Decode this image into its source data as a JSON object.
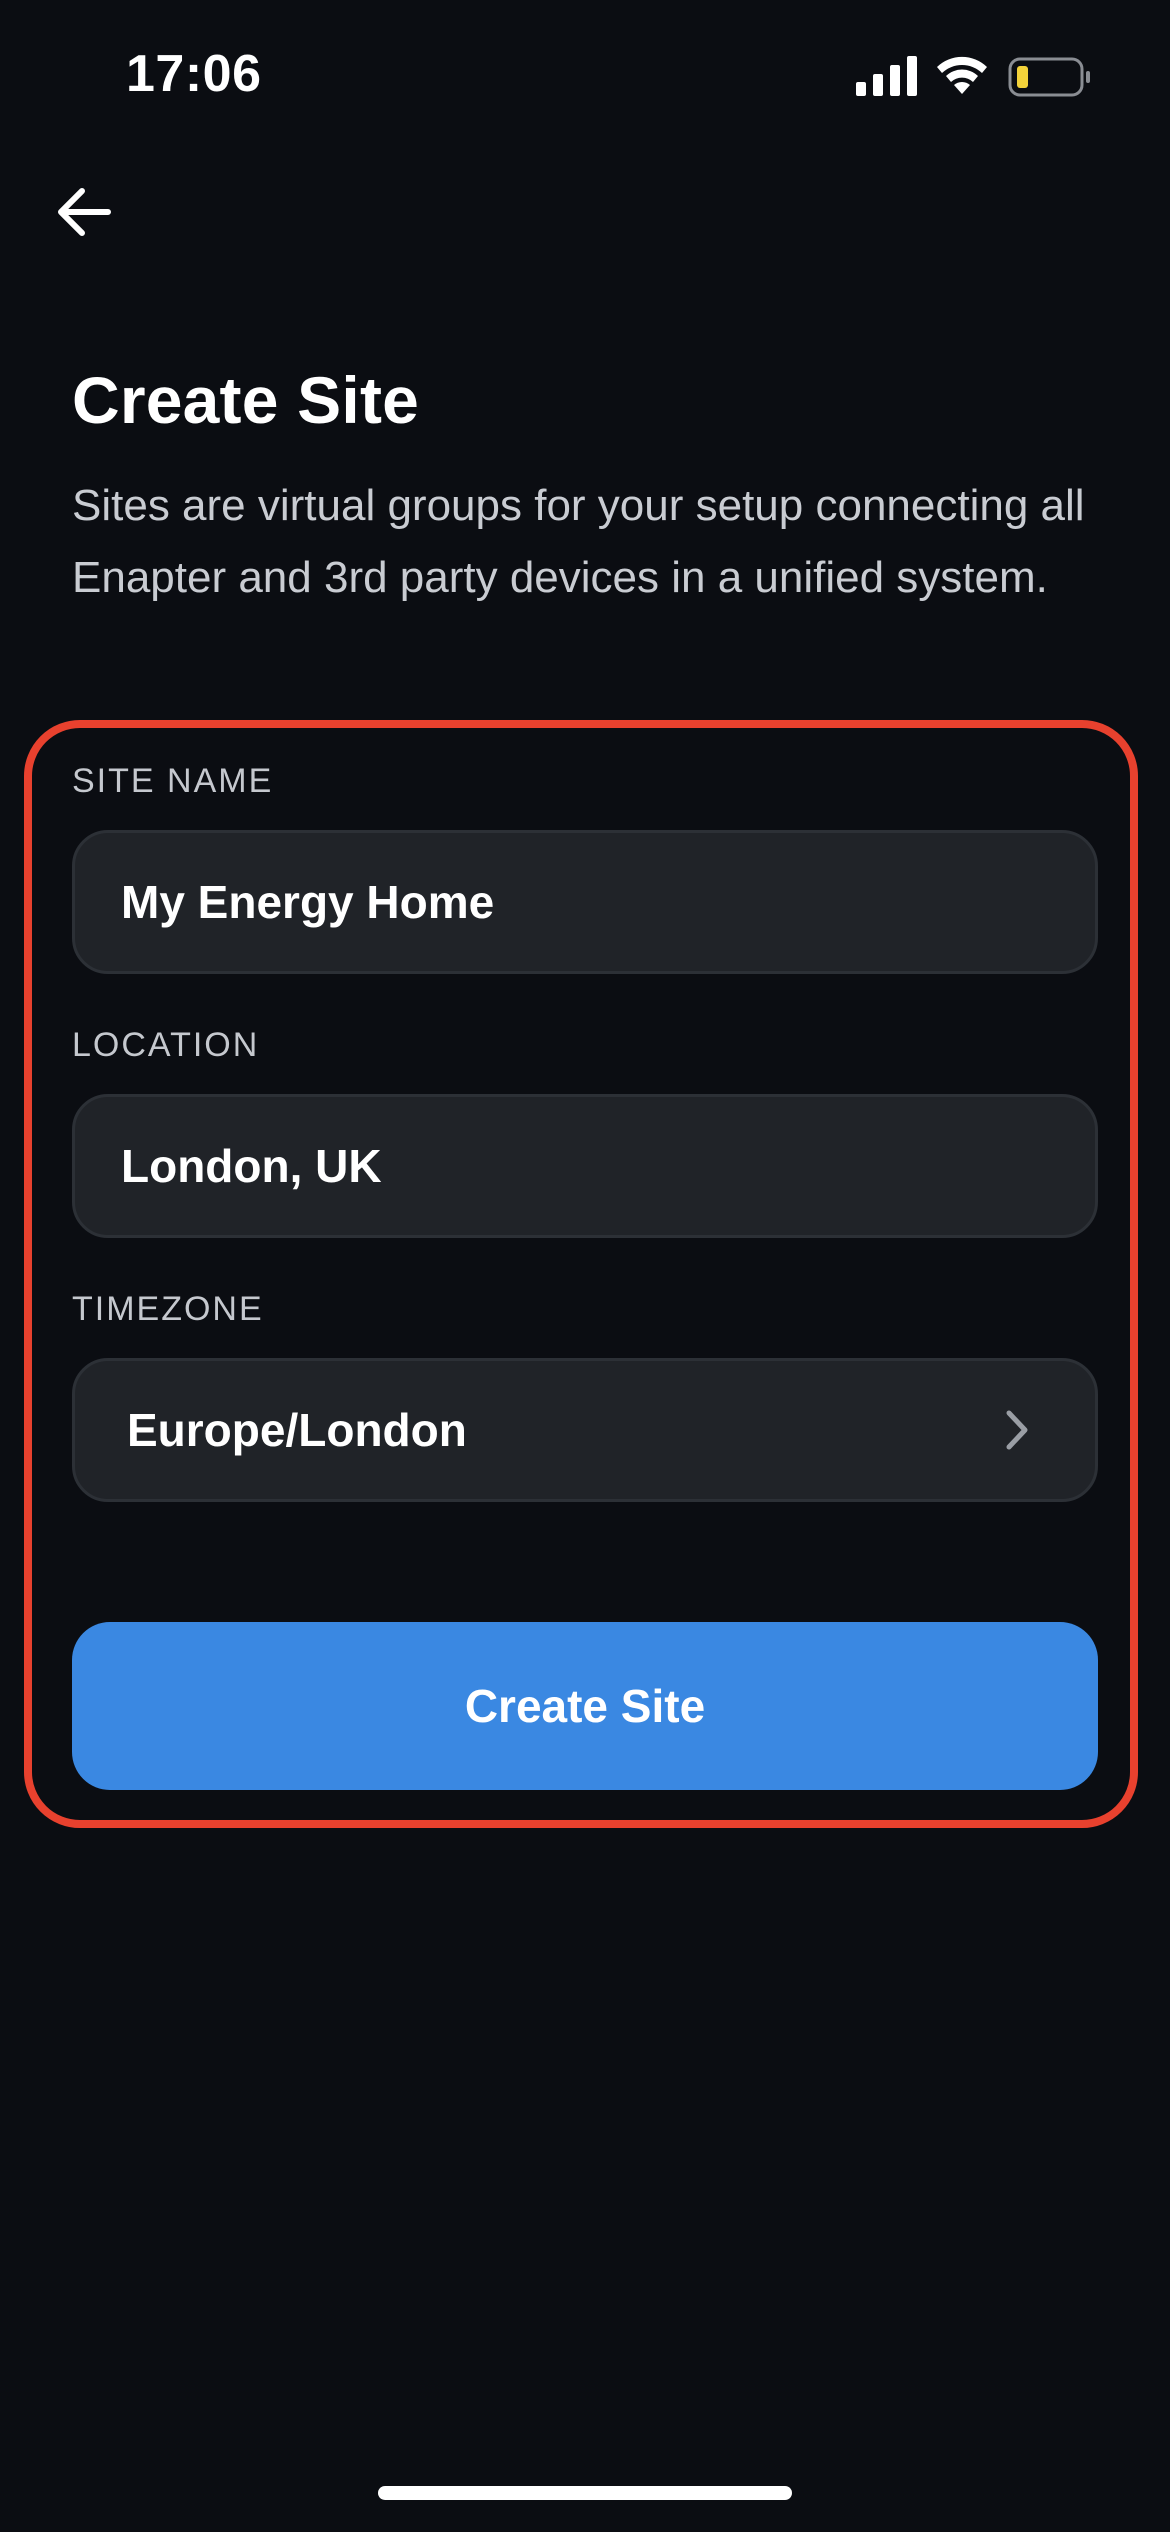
{
  "status_bar": {
    "time": "17:06",
    "signal_icon": "cellular-signal-icon",
    "wifi_icon": "wifi-icon",
    "battery_icon": "battery-low-icon",
    "battery_fill_color": "#f3d23a"
  },
  "navigation": {
    "back_icon": "arrow-left-icon"
  },
  "header": {
    "title": "Create Site",
    "description": "Sites are virtual groups for your setup connecting all Enapter and 3rd party devices in a unified system."
  },
  "form": {
    "site_name": {
      "label": "SITE NAME",
      "value": "My Energy Home"
    },
    "location": {
      "label": "LOCATION",
      "value": "London, UK"
    },
    "timezone": {
      "label": "TIMEZONE",
      "value": "Europe/London",
      "icon": "chevron-right-icon"
    },
    "submit_label": "Create Site"
  },
  "colors": {
    "background": "#0b0d12",
    "highlight_border": "#e8412e",
    "primary_button": "#3a88e2",
    "field_background": "#202328"
  }
}
